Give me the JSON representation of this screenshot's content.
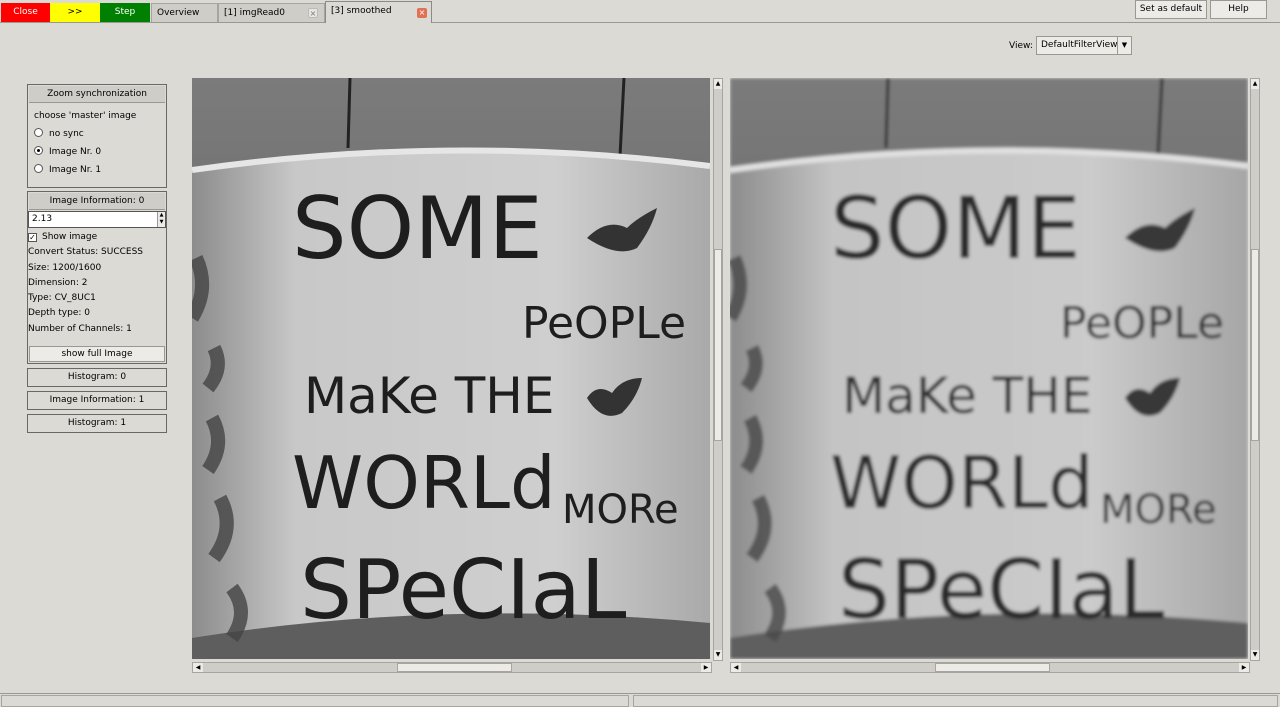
{
  "toolbar": {
    "close_label": "Close",
    "forward_label": ">>",
    "step_label": "Step",
    "colors": {
      "close": "#ff0000",
      "forward": "#ffff00",
      "step": "#008000"
    }
  },
  "tabs": [
    {
      "label": "Overview"
    },
    {
      "label": "[1] imgRead0"
    },
    {
      "label": "[3] smoothed"
    }
  ],
  "tab_close_icon": "×",
  "view": {
    "label": "View:",
    "selected": "DefaultFilterView",
    "set_default_label": "Set as default",
    "help_label": "Help"
  },
  "zoom": {
    "header": "Zoom synchronization",
    "prompt": "choose 'master' image",
    "options": [
      "no sync",
      "Image Nr. 0",
      "Image Nr. 1"
    ],
    "selected_index": 1
  },
  "image_info_0": {
    "header": "Image Information: 0",
    "zoom_value": "2.13",
    "show_image_label": "Show image",
    "show_image_checked": true,
    "convert_status": "Convert Status: SUCCESS",
    "size": "Size: 1200/1600",
    "dimension": "Dimension: 2",
    "type": "Type: CV_8UC1",
    "depth": "Depth type: 0",
    "channels": "Number of Channels: 1",
    "show_full_label": "show full Image"
  },
  "collapsed_sections": {
    "histogram_0": "Histogram: 0",
    "image_info_1": "Image Information: 1",
    "histogram_1": "Histogram: 1"
  },
  "mug_text": {
    "line1": "SOME",
    "line2": "PeOPLe",
    "line3": "MaKe THE",
    "line4a": "WORLd",
    "line4b": "MORe",
    "line5": "SPeCIaL"
  }
}
